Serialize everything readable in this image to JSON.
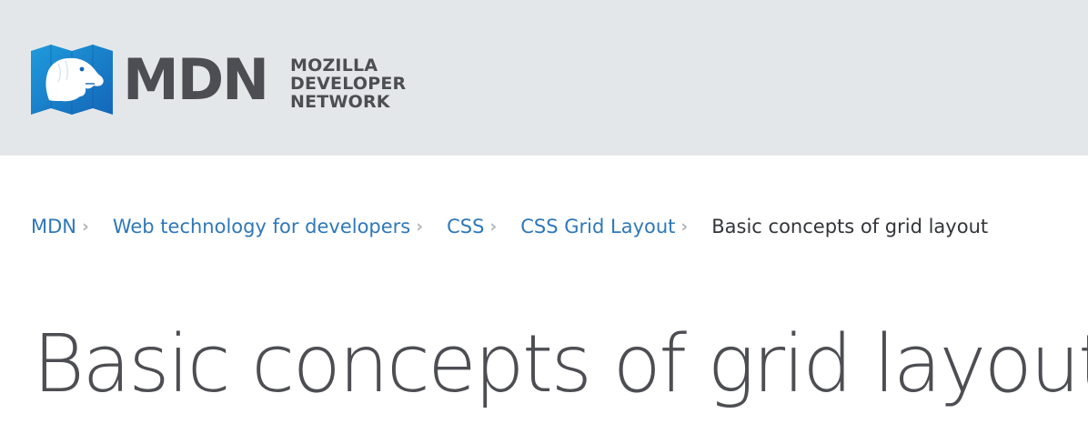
{
  "header": {
    "logo": {
      "icon": "mdn-dinosaur-head-icon",
      "wordmark": "MDN",
      "tagline": [
        "MOZILLA",
        "DEVELOPER",
        "NETWORK"
      ],
      "colors": {
        "icon_blue": "#1e8ad6",
        "text": "#4d4e53"
      }
    },
    "background": "#e4e7ea"
  },
  "breadcrumb": {
    "items": [
      {
        "label": "MDN"
      },
      {
        "label": "Web technology for developers"
      },
      {
        "label": "CSS"
      },
      {
        "label": "CSS Grid Layout"
      }
    ],
    "current": "Basic concepts of grid layout",
    "separator_icon": "chevron-right-icon",
    "link_color": "#2f78b8"
  },
  "page": {
    "title": "Basic concepts of grid layout"
  }
}
